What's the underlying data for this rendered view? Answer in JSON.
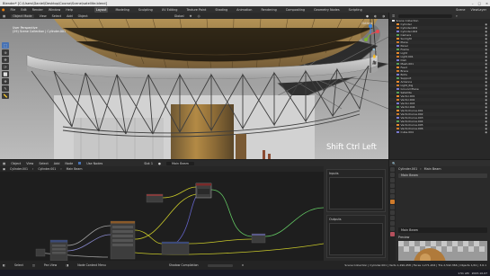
{
  "window": {
    "title": "Blender* [C:\\Users\\Daniel\\Desktop\\Course\\Scene\\satellite.blend]"
  },
  "menubar": {
    "menus": [
      "File",
      "Edit",
      "Render",
      "Window",
      "Help"
    ],
    "workspaces": [
      "Layout",
      "Modeling",
      "Sculpting",
      "UV Editing",
      "Texture Paint",
      "Shading",
      "Animation",
      "Rendering",
      "Compositing",
      "Geometry Nodes",
      "Scripting"
    ],
    "active_workspace": "Layout",
    "scene": "Scene",
    "view_layer": "ViewLayer"
  },
  "viewport": {
    "mode": "Object Mode",
    "menus": [
      "View",
      "Select",
      "Add",
      "Object"
    ],
    "transform": "Global",
    "options": "Options",
    "info_line1": "User Perspective",
    "info_line2": "(29) Scene Collection | Cylinder.001",
    "overlay_text": "Shift Ctrl Left"
  },
  "outliner": {
    "search_placeholder": "",
    "root": "Scene Collection",
    "items": [
      "Cylinder",
      "Cylinder.001",
      "Cylinder.002",
      "Camera",
      "Sunlight",
      "Plane",
      "Panel",
      "Frame",
      "Light",
      "Light.001",
      "Dish",
      "Mesh.001",
      "Feed",
      "Brace",
      "Bolts",
      "Support",
      "Antenna",
      "Light_Rig",
      "Ground Plane",
      "Satellite",
      "Vector.001",
      "Vector.002",
      "Vector.003",
      "Vector.004",
      "VectorCurve.001",
      "VectorCurve.002",
      "VectorCurve.003",
      "VectorCurve.004",
      "VectorCurve.005",
      "VectorCurve.006",
      "Cube.004"
    ]
  },
  "node_editor": {
    "type": "Object",
    "menus": [
      "View",
      "Select",
      "Add",
      "Node"
    ],
    "use_nodes": "Use Nodes",
    "slot": "Slot 1",
    "material": "Main Beam",
    "breadcrumbs": [
      "Cylinder.001",
      "Cylinder.001",
      "Main Beam"
    ],
    "side_panels": [
      "Inputs",
      "Outputs"
    ]
  },
  "properties": {
    "object": "Cylinder.001",
    "material": "Main Beam",
    "material_slot": "Main Beam",
    "preview_label": "Preview"
  },
  "statusbar": {
    "left_items": [
      "Select",
      "Pan View",
      "Node Context Menu"
    ],
    "center": "Shadow Compilation",
    "progress": 0,
    "stats": "Scene Collection | Cylinder.001 | Verts 1,290,458 | Faces 1,271,204 | Tris 2,542,366 | Objects 1/41 | 3.6.1"
  },
  "taskbar": {
    "time": "1:51 AM",
    "date": "2023-10-07"
  }
}
